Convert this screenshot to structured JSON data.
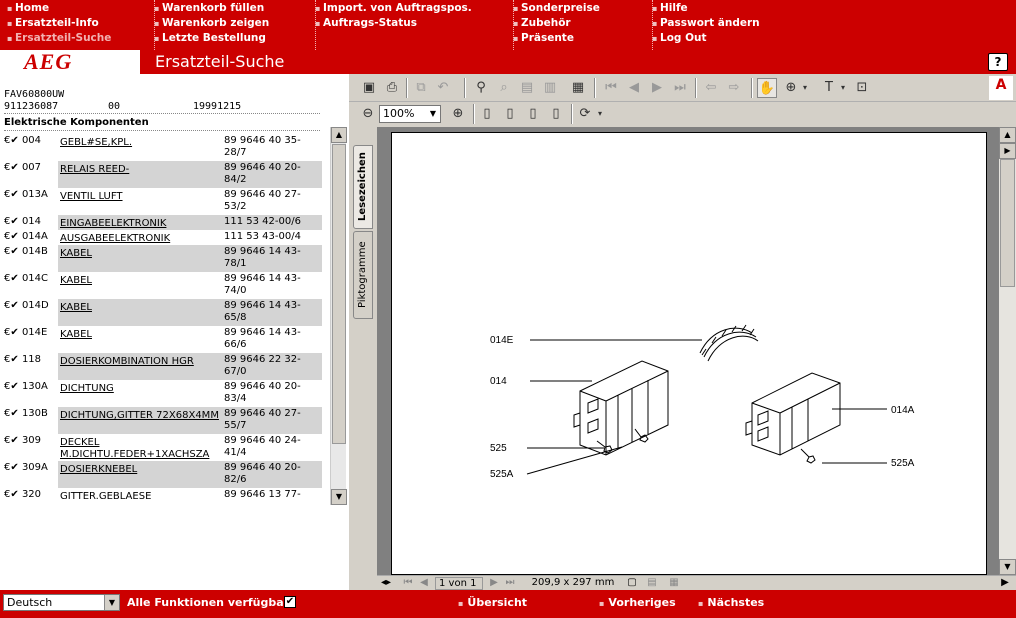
{
  "nav": {
    "col1": [
      "Home",
      "Ersatzteil-Info",
      "Ersatzteil-Suche"
    ],
    "col2": [
      "Warenkorb füllen",
      "Warenkorb zeigen",
      "Letzte Bestellung"
    ],
    "col3": [
      "Import. von Auftragspos.",
      "Auftrags-Status"
    ],
    "col4": [
      "Sonderpreise",
      "Zubehör",
      "Präsente"
    ],
    "col5": [
      "Hilfe",
      "Passwort ändern",
      "Log Out"
    ]
  },
  "header": {
    "logo": "AEG",
    "title": "Ersatzteil-Suche",
    "help": "?"
  },
  "product": {
    "model": "FAV60800UW",
    "code": "911236087",
    "index": "00",
    "date": "19991215"
  },
  "section_title": "Elektrische Komponenten",
  "parts": [
    {
      "pos": "004",
      "name": "GEBL#SE,KPL.",
      "number": "89 9646 40 35-28/7"
    },
    {
      "pos": "007",
      "name": "RELAIS REED-",
      "number": "89 9646 40 20-84/2"
    },
    {
      "pos": "013A",
      "name": "VENTIL LUFT",
      "number": "89 9646 40 27-53/2"
    },
    {
      "pos": "014",
      "name": "EINGABEELEKTRONIK",
      "number": "111 53 42-00/6"
    },
    {
      "pos": "014A",
      "name": "AUSGABEELEKTRONIK",
      "number": "111 53 43-00/4"
    },
    {
      "pos": "014B",
      "name": "KABEL",
      "number": "89 9646 14 43-78/1"
    },
    {
      "pos": "014C",
      "name": "KABEL",
      "number": "89 9646 14 43-74/0"
    },
    {
      "pos": "014D",
      "name": "KABEL",
      "number": "89 9646 14 43-65/8"
    },
    {
      "pos": "014E",
      "name": "KABEL",
      "number": "89 9646 14 43-66/6"
    },
    {
      "pos": "118",
      "name": "DOSIERKOMBINATION HGR",
      "number": "89 9646 22 32-67/0"
    },
    {
      "pos": "130A",
      "name": "DICHTUNG",
      "number": "89 9646 40 20-83/4"
    },
    {
      "pos": "130B",
      "name": "DICHTUNG,GITTER 72X68X4MM",
      "number": "89 9646 40 27-55/7"
    },
    {
      "pos": "309",
      "name": "DECKEL M.DICHTU.FEDER+1XACHSZA",
      "number": "89 9646 40 24-41/4"
    },
    {
      "pos": "309A",
      "name": "DOSIERKNEBEL",
      "number": "89 9646 40 20-82/6"
    },
    {
      "pos": "320",
      "name": "GITTER.GEBLAESE",
      "number": "89 9646 13 77-"
    }
  ],
  "row_prefix": "€✔",
  "viewer": {
    "zoom": "100%",
    "tabs": [
      "Lesezeichen",
      "Piktogramme"
    ],
    "page_indicator": "1 von 1",
    "page_size": "209,9 x 297 mm",
    "diagram_labels": [
      "014E",
      "014",
      "525",
      "525A",
      "014A",
      "525A"
    ]
  },
  "footer": {
    "language": "Deutsch",
    "all_functions": "Alle Funktionen verfügbar:",
    "links": [
      "Übersicht",
      "Vorheriges",
      "Nächstes"
    ]
  }
}
